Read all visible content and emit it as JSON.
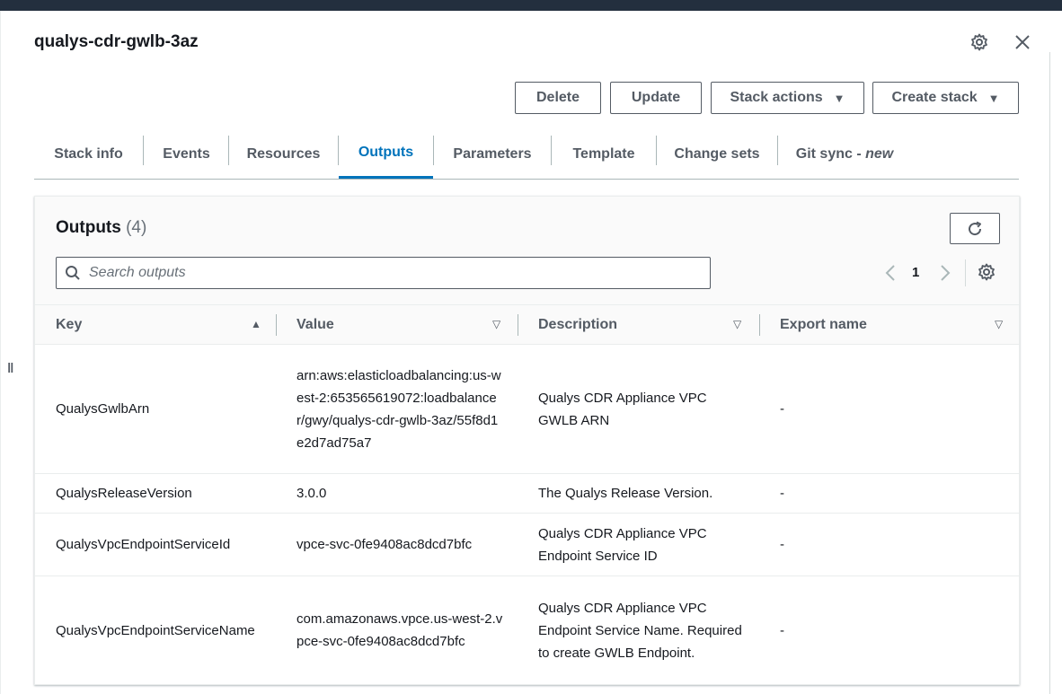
{
  "header": {
    "stack_name": "qualys-cdr-gwlb-3az",
    "settings_icon": "gear-icon",
    "close_icon": "close-icon"
  },
  "actions": {
    "delete": "Delete",
    "update": "Update",
    "stack_actions": "Stack actions",
    "create_stack": "Create stack"
  },
  "tabs": [
    {
      "label": "Stack info"
    },
    {
      "label": "Events"
    },
    {
      "label": "Resources"
    },
    {
      "label": "Outputs",
      "active": true
    },
    {
      "label": "Parameters"
    },
    {
      "label": "Template"
    },
    {
      "label": "Change sets"
    },
    {
      "label": "Git sync - ",
      "suffix": "new"
    }
  ],
  "outputs": {
    "title": "Outputs",
    "count": "(4)",
    "search_placeholder": "Search outputs",
    "page": "1",
    "columns": [
      "Key",
      "Value",
      "Description",
      "Export name"
    ],
    "rows": [
      {
        "key": "QualysGwlbArn",
        "value": "arn:aws:elasticloadbalancing:us-west-2:653565619072:loadbalancer/gwy/qualys-cdr-gwlb-3az/55f8d1e2d7ad75a7",
        "description": "Qualys CDR Appliance VPC GWLB ARN",
        "export": "-"
      },
      {
        "key": "QualysReleaseVersion",
        "value": "3.0.0",
        "description": "The Qualys Release Version.",
        "export": "-"
      },
      {
        "key": "QualysVpcEndpointServiceId",
        "value": "vpce-svc-0fe9408ac8dcd7bfc",
        "description": "Qualys CDR Appliance VPC Endpoint Service ID",
        "export": "-"
      },
      {
        "key": "QualysVpcEndpointServiceName",
        "value": "com.amazonaws.vpce.us-west-2.vpce-svc-0fe9408ac8dcd7bfc",
        "description": "Qualys CDR Appliance VPC Endpoint Service Name. Required to create GWLB Endpoint.",
        "export": "-"
      }
    ]
  },
  "colors": {
    "accent": "#0073bb",
    "topbar": "#232f3e",
    "text": "#16191f",
    "muted": "#545b64"
  }
}
